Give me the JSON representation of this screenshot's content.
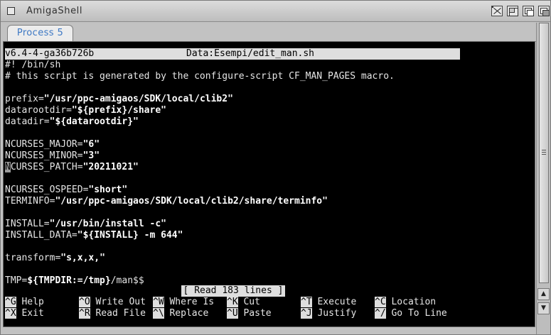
{
  "window": {
    "title": "AmigaShell"
  },
  "tabs": [
    {
      "label": "Process 5",
      "active": true
    }
  ],
  "editor": {
    "version": "v6.4-4-ga36b726b",
    "file": "Data:Esempi/edit_man.sh",
    "status": "[ Read 183 lines ]"
  },
  "lines": [
    {
      "plain": "#! /bin/sh"
    },
    {
      "plain": "# this script is generated by the configure-script CF_MAN_PAGES macro."
    },
    {
      "plain": ""
    },
    {
      "pre": "prefix=",
      "str": "\"/usr/ppc-amigaos/SDK/local/clib2\""
    },
    {
      "pre": "datarootdir=",
      "str": "\"${prefix}/share\""
    },
    {
      "pre": "datadir=",
      "str": "\"${datarootdir}\""
    },
    {
      "plain": ""
    },
    {
      "pre": "NCURSES_MAJOR=",
      "str": "\"6\""
    },
    {
      "pre": "NCURSES_MINOR=",
      "str": "\"3\""
    },
    {
      "cursor": "N",
      "pre": "CURSES_PATCH=",
      "str": "\"20211021\""
    },
    {
      "plain": ""
    },
    {
      "pre": "NCURSES_OSPEED=",
      "str": "\"short\""
    },
    {
      "pre": "TERMINFO=",
      "str": "\"/usr/ppc-amigaos/SDK/local/clib2/share/terminfo\""
    },
    {
      "plain": ""
    },
    {
      "pre": "INSTALL=",
      "str": "\"/usr/bin/install -c\""
    },
    {
      "pre": "INSTALL_DATA=",
      "str": "\"${INSTALL} -m 644\""
    },
    {
      "plain": ""
    },
    {
      "pre": "transform=",
      "str": "\"s,x,x,\""
    },
    {
      "plain": ""
    },
    {
      "pre": "TMP=",
      "str": "${TMPDIR:=/tmp}",
      "post": "/man$$"
    }
  ],
  "shortcuts": [
    [
      {
        "key": "^G",
        "label": "Help"
      },
      {
        "key": "^O",
        "label": "Write Out"
      },
      {
        "key": "^W",
        "label": "Where Is"
      },
      {
        "key": "^K",
        "label": "Cut"
      },
      {
        "key": "^T",
        "label": "Execute"
      },
      {
        "key": "^C",
        "label": "Location"
      }
    ],
    [
      {
        "key": "^X",
        "label": "Exit"
      },
      {
        "key": "^R",
        "label": "Read File"
      },
      {
        "key": "^\\",
        "label": "Replace"
      },
      {
        "key": "^U",
        "label": "Paste"
      },
      {
        "key": "^J",
        "label": "Justify"
      },
      {
        "key": "^/",
        "label": "Go To Line"
      }
    ]
  ]
}
